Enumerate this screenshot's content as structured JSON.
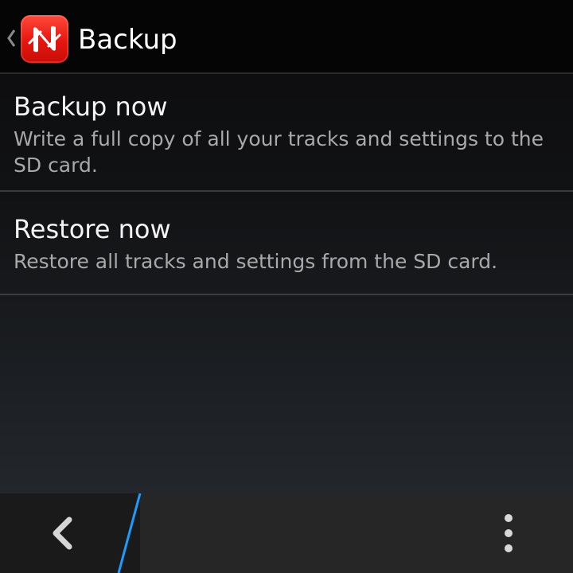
{
  "action_bar": {
    "title": "Backup",
    "up_icon": "chevron-left-icon",
    "app_icon": "app-n-logo-icon",
    "app_icon_color": "#e8180f"
  },
  "list": {
    "items": [
      {
        "title": "Backup now",
        "summary": "Write a full copy of all your tracks and settings to the SD card."
      },
      {
        "title": "Restore now",
        "summary": "Restore all tracks and settings from the SD card."
      }
    ]
  },
  "bottom_bar": {
    "back_icon": "chevron-left-icon",
    "overflow_icon": "overflow-menu-icon",
    "accent_color": "#1e9bff"
  }
}
